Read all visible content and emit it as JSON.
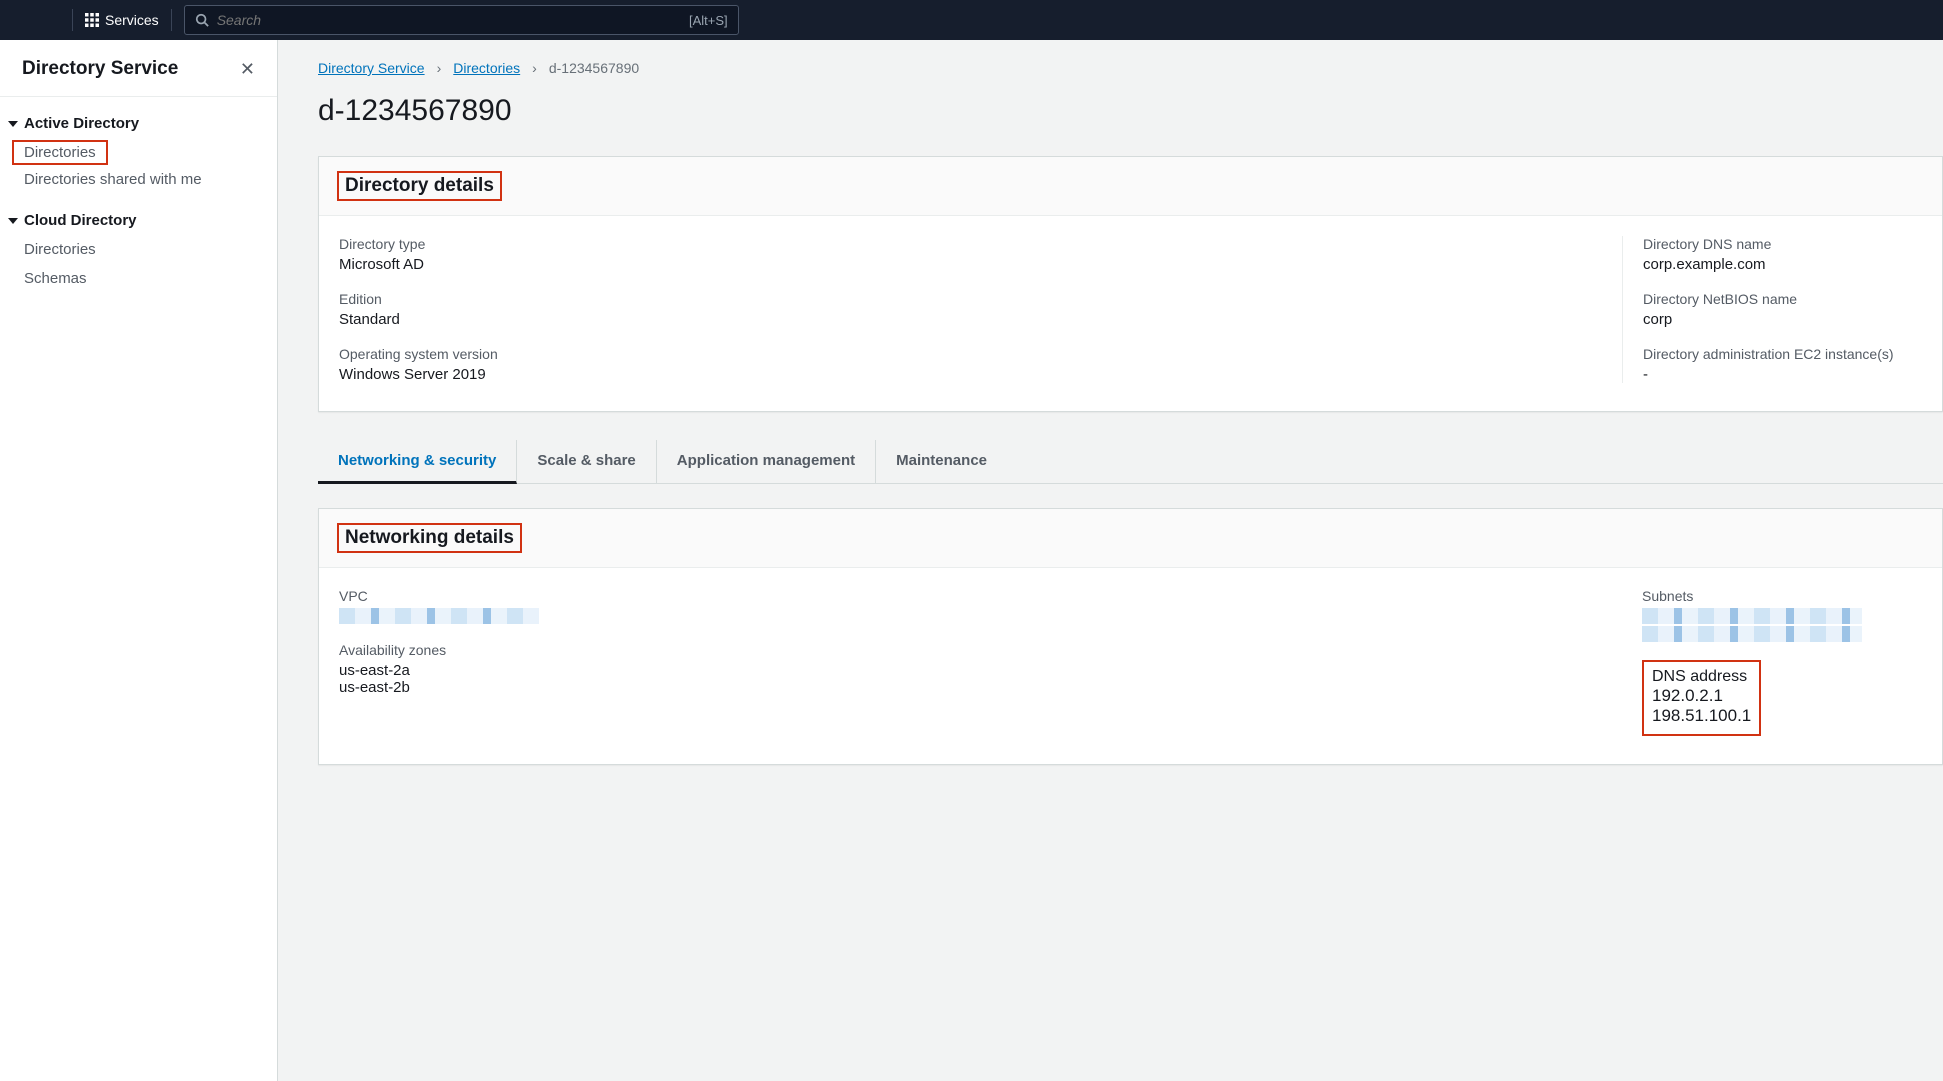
{
  "topnav": {
    "services_label": "Services",
    "search_placeholder": "Search",
    "shortcut": "[Alt+S]"
  },
  "sidebar": {
    "title": "Directory Service",
    "groups": [
      {
        "label": "Active Directory",
        "items": [
          {
            "label": "Directories",
            "highlighted": true
          },
          {
            "label": "Directories shared with me",
            "highlighted": false
          }
        ]
      },
      {
        "label": "Cloud Directory",
        "items": [
          {
            "label": "Directories",
            "highlighted": false
          },
          {
            "label": "Schemas",
            "highlighted": false
          }
        ]
      }
    ]
  },
  "breadcrumb": {
    "items": [
      "Directory Service",
      "Directories"
    ],
    "current": "d-1234567890"
  },
  "page_title": "d-1234567890",
  "details_panel": {
    "heading": "Directory details",
    "left": [
      {
        "label": "Directory type",
        "value": "Microsoft AD"
      },
      {
        "label": "Edition",
        "value": "Standard"
      },
      {
        "label": "Operating system version",
        "value": "Windows Server 2019"
      }
    ],
    "right": [
      {
        "label": "Directory DNS name",
        "value": "corp.example.com"
      },
      {
        "label": "Directory NetBIOS name",
        "value": "corp"
      },
      {
        "label": "Directory administration EC2 instance(s)",
        "value": "-"
      }
    ]
  },
  "tabs": [
    {
      "label": "Networking & security",
      "active": true
    },
    {
      "label": "Scale & share",
      "active": false
    },
    {
      "label": "Application management",
      "active": false
    },
    {
      "label": "Maintenance",
      "active": false
    }
  ],
  "networking_panel": {
    "heading": "Networking details",
    "vpc_label": "VPC",
    "az_label": "Availability zones",
    "az_values": [
      "us-east-2a",
      "us-east-2b"
    ],
    "subnets_label": "Subnets",
    "dns_label": "DNS address",
    "dns_values": [
      "192.0.2.1",
      "198.51.100.1"
    ]
  }
}
